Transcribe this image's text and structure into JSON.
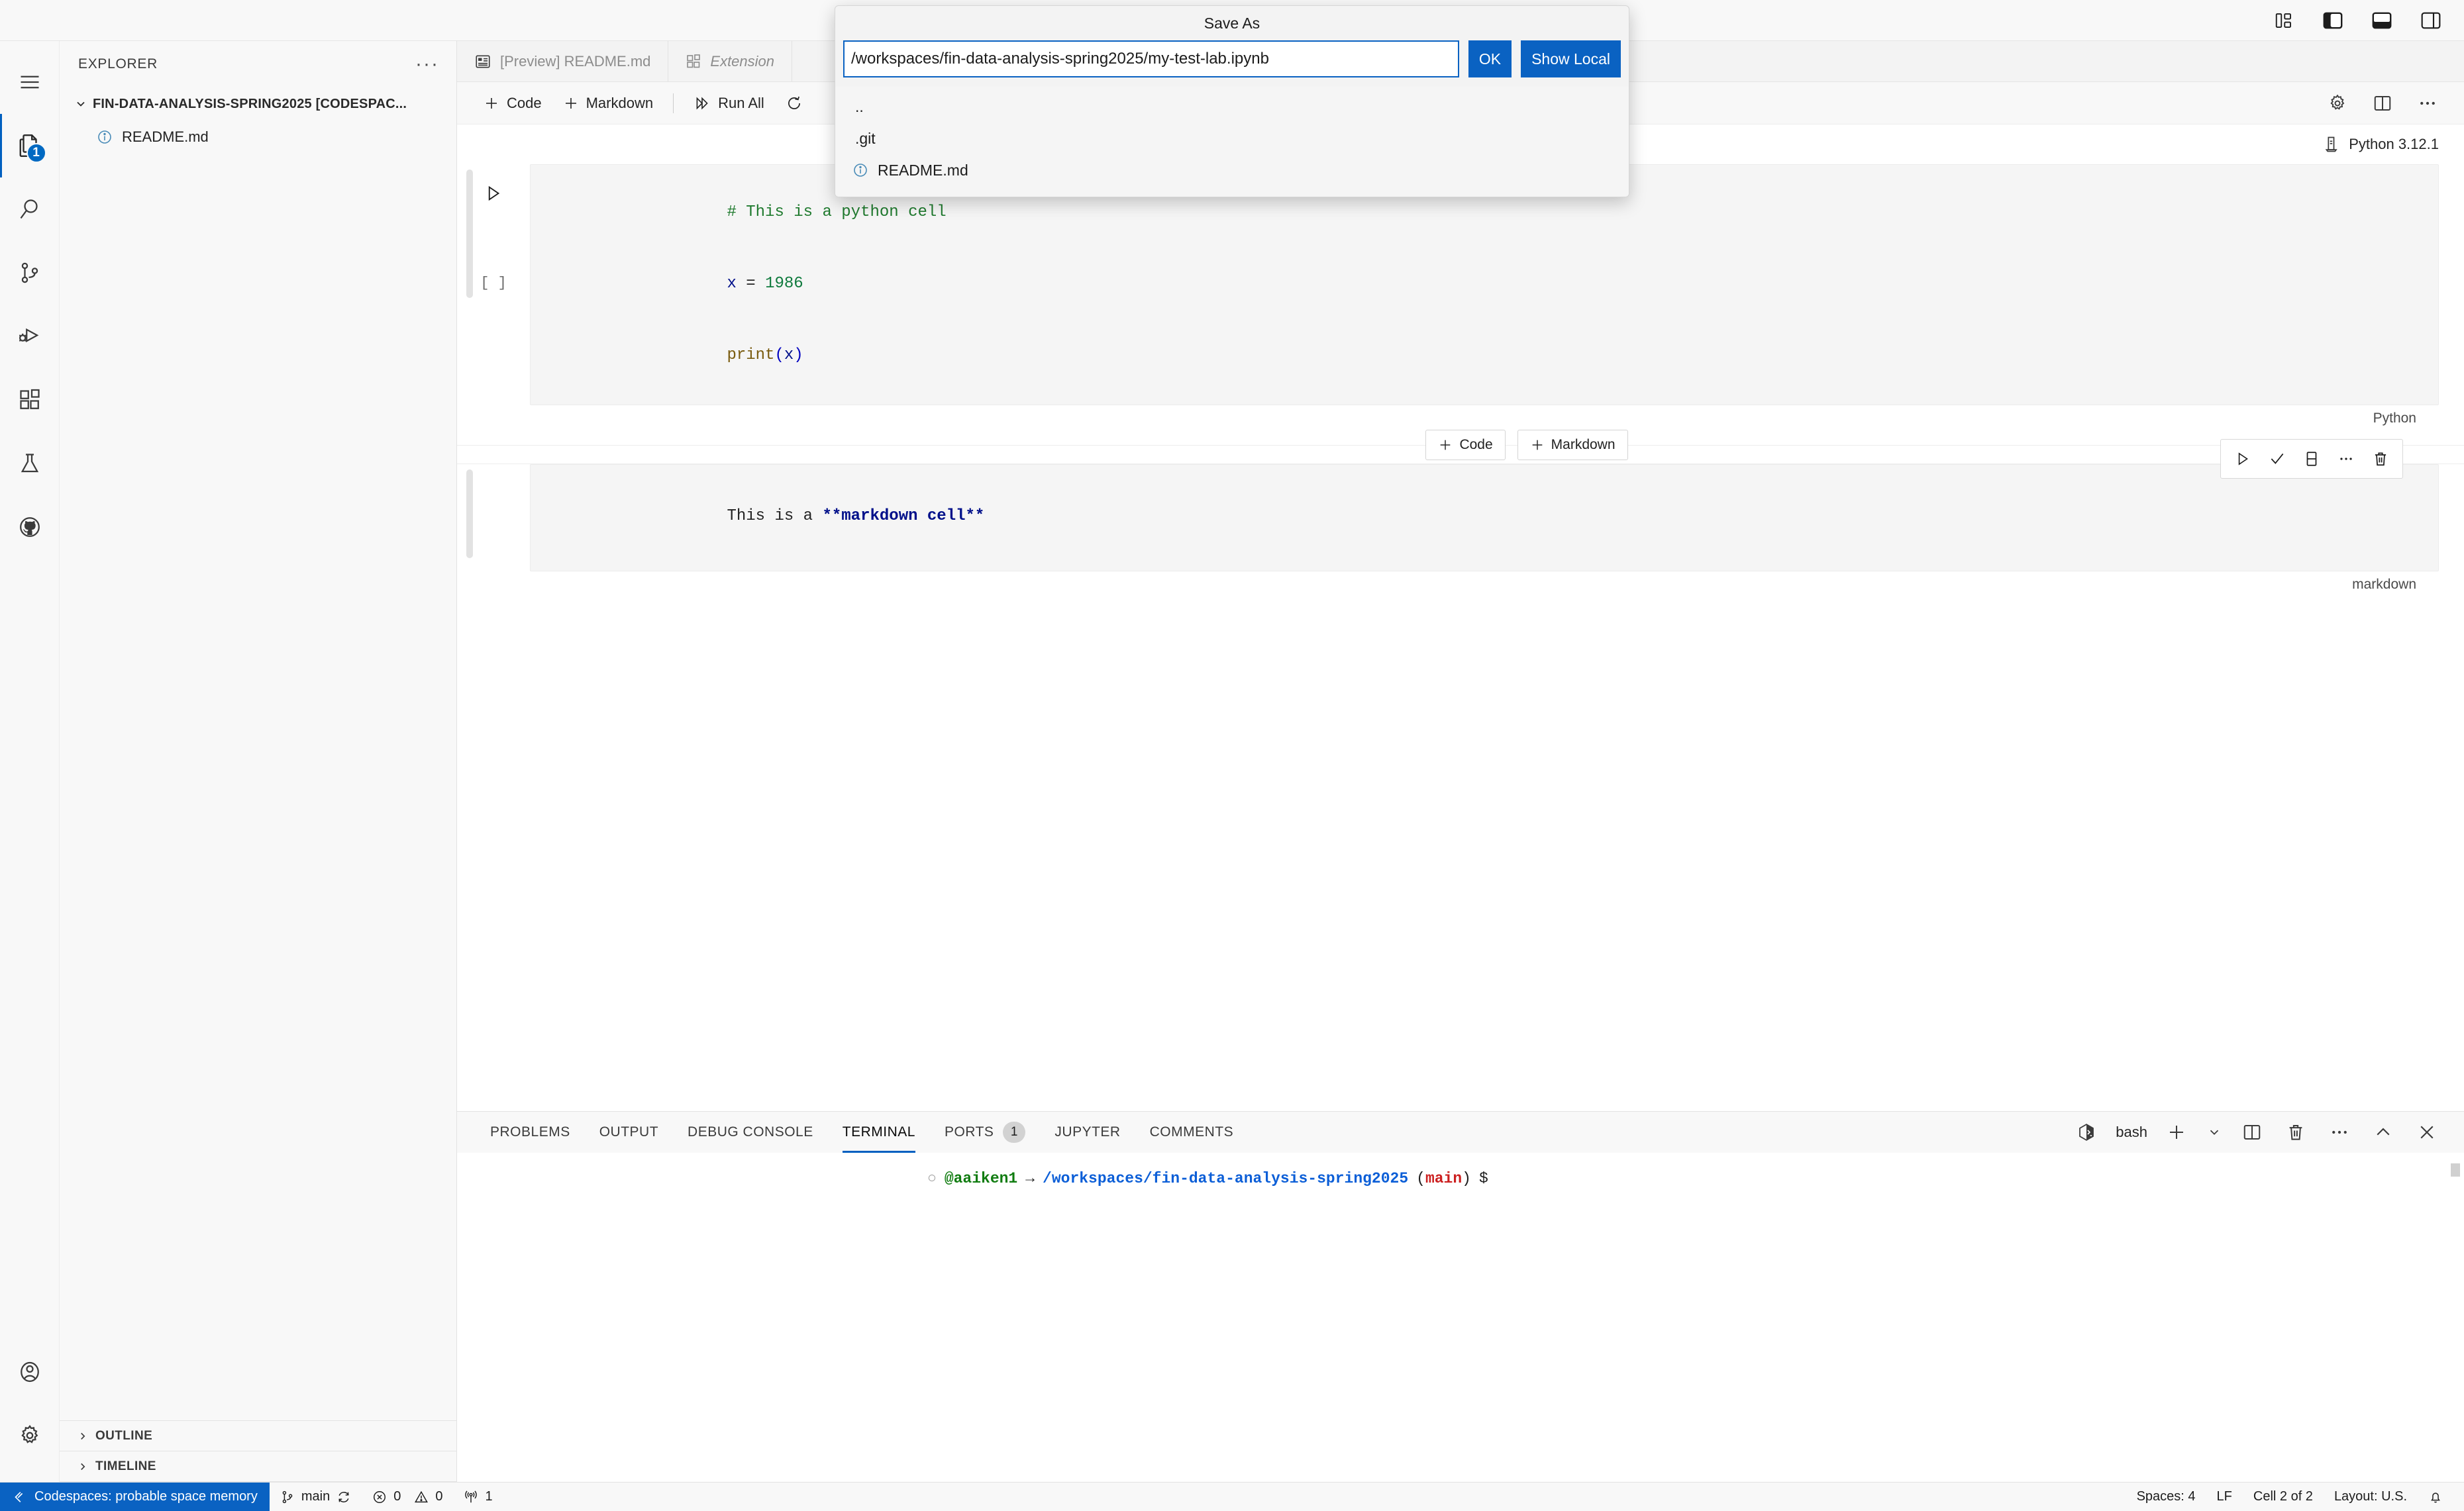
{
  "titlebar": {
    "controls": [
      {
        "name": "customize-layout-icon",
        "label": "Customize Layout",
        "active": false
      },
      {
        "name": "toggle-primary-sidebar-icon",
        "label": "Toggle Primary Side Bar",
        "active": true
      },
      {
        "name": "toggle-panel-icon",
        "label": "Toggle Panel",
        "active": true
      },
      {
        "name": "toggle-secondary-sidebar-icon",
        "label": "Toggle Secondary Side Bar",
        "active": false
      }
    ]
  },
  "activitybar": {
    "items": [
      {
        "name": "menu",
        "label": "Application Menu",
        "icon": "hamburger-icon",
        "active": false,
        "badge": null
      },
      {
        "name": "explorer",
        "label": "Explorer",
        "icon": "files-icon",
        "active": true,
        "badge": "1"
      },
      {
        "name": "search",
        "label": "Search",
        "icon": "search-icon",
        "active": false,
        "badge": null
      },
      {
        "name": "source-control",
        "label": "Source Control",
        "icon": "source-control-icon",
        "active": false,
        "badge": null
      },
      {
        "name": "run-debug",
        "label": "Run and Debug",
        "icon": "run-debug-icon",
        "active": false,
        "badge": null
      },
      {
        "name": "extensions",
        "label": "Extensions",
        "icon": "extensions-icon",
        "active": false,
        "badge": null
      },
      {
        "name": "testing",
        "label": "Testing",
        "icon": "beaker-icon",
        "active": false,
        "badge": null
      },
      {
        "name": "github",
        "label": "GitHub",
        "icon": "github-icon",
        "active": false,
        "badge": null
      }
    ],
    "bottom": [
      {
        "name": "accounts",
        "label": "Accounts",
        "icon": "account-icon"
      },
      {
        "name": "manage",
        "label": "Manage",
        "icon": "gear-icon"
      }
    ]
  },
  "sidebar": {
    "title": "EXPLORER",
    "more_actions": "···",
    "root_folder": "FIN-DATA-ANALYSIS-SPRING2025 [CODESPAC...",
    "files": [
      {
        "name": "README.md",
        "icon": "info-file-icon"
      }
    ],
    "sections": [
      {
        "label": "OUTLINE",
        "expanded": false
      },
      {
        "label": "TIMELINE",
        "expanded": false
      }
    ]
  },
  "tabs": [
    {
      "label": "[Preview] README.md",
      "icon": "preview-icon",
      "italic": false,
      "active": false
    },
    {
      "label": "Extension",
      "icon": "extensions-icon",
      "italic": true,
      "active": false
    }
  ],
  "notebook_toolbar": {
    "add_code": "Code",
    "add_markdown": "Markdown",
    "run_all": "Run All",
    "restart_icon": "restart-icon",
    "right_icons": [
      {
        "name": "gear-icon",
        "label": "Settings"
      },
      {
        "name": "split-editor-icon",
        "label": "Split Editor"
      },
      {
        "name": "more-actions-icon",
        "label": "More Actions"
      }
    ]
  },
  "kernel": {
    "icon": "kernel-icon",
    "label": "Python 3.12.1"
  },
  "cells": [
    {
      "type": "code",
      "language_label": "Python",
      "execution_count": "[ ]",
      "lines": [
        {
          "tokens": [
            {
              "t": "# This is a python cell",
              "c": "tok-comment"
            }
          ]
        },
        {
          "tokens": [
            {
              "t": "x",
              "c": "tok-var"
            },
            {
              "t": " = ",
              "c": "tok-op"
            },
            {
              "t": "1986",
              "c": "tok-num"
            }
          ]
        },
        {
          "tokens": [
            {
              "t": "print",
              "c": "tok-fn"
            },
            {
              "t": "(",
              "c": "tok-paren"
            },
            {
              "t": "x",
              "c": "tok-var"
            },
            {
              "t": ")",
              "c": "tok-paren"
            }
          ]
        }
      ]
    },
    {
      "type": "markdown",
      "language_label": "markdown",
      "lines": [
        {
          "tokens": [
            {
              "t": "This is a ",
              "c": "tok-op"
            },
            {
              "t": "**markdown cell**",
              "c": "tok-var"
            }
          ]
        }
      ],
      "toolbar_icons": [
        {
          "name": "run-cell-icon",
          "label": "Execute Cell"
        },
        {
          "name": "check-icon",
          "label": "Stop Editing Cell"
        },
        {
          "name": "split-cell-icon",
          "label": "Split Cell"
        },
        {
          "name": "more-actions-icon",
          "label": "More Actions"
        },
        {
          "name": "delete-icon",
          "label": "Delete Cell"
        }
      ]
    }
  ],
  "insert_buttons": {
    "code": "Code",
    "markdown": "Markdown"
  },
  "panel": {
    "tabs": [
      {
        "label": "PROBLEMS",
        "active": false,
        "badge": null
      },
      {
        "label": "OUTPUT",
        "active": false,
        "badge": null
      },
      {
        "label": "DEBUG CONSOLE",
        "active": false,
        "badge": null
      },
      {
        "label": "TERMINAL",
        "active": true,
        "badge": null
      },
      {
        "label": "PORTS",
        "active": false,
        "badge": "1"
      },
      {
        "label": "JUPYTER",
        "active": false,
        "badge": null
      },
      {
        "label": "COMMENTS",
        "active": false,
        "badge": null
      }
    ],
    "shell_label": "bash",
    "right_icons": [
      {
        "name": "terminal-bash-icon",
        "label": "bash"
      },
      {
        "name": "new-terminal-icon",
        "label": "New Terminal"
      },
      {
        "name": "chevron-down-icon",
        "label": "Launch Profile"
      },
      {
        "name": "split-terminal-icon",
        "label": "Split Terminal"
      },
      {
        "name": "kill-terminal-icon",
        "label": "Kill Terminal"
      },
      {
        "name": "more-actions-icon",
        "label": "Views and More Actions"
      },
      {
        "name": "maximize-panel-icon",
        "label": "Maximize Panel Size"
      },
      {
        "name": "close-panel-icon",
        "label": "Close Panel"
      }
    ],
    "terminal_line": {
      "marker": "○",
      "user": "@aaiken1",
      "arrow": "→",
      "path": "/workspaces/fin-data-analysis-spring2025",
      "open_paren": "(",
      "branch": "main",
      "close_paren": ")",
      "prompt": "$"
    }
  },
  "statusbar": {
    "remote": "Codespaces: probable space memory",
    "remote_icon": "remote-icon",
    "branch": "main",
    "branch_icon": "source-control-icon",
    "sync_icon": "sync-icon",
    "errors": "0",
    "warnings": "0",
    "ports": "1",
    "error_icon": "error-icon",
    "warning_icon": "warning-icon",
    "ports_icon": "radio-tower-icon",
    "spaces": "Spaces: 4",
    "eol": "LF",
    "cell_position": "Cell 2 of 2",
    "layout": "Layout: U.S.",
    "bell_icon": "bell-icon"
  },
  "quickinput": {
    "title": "Save As",
    "value": "/workspaces/fin-data-analysis-spring2025/my-test-lab.ipynb",
    "ok_label": "OK",
    "show_local_label": "Show Local",
    "items": [
      {
        "label": "..",
        "icon": null
      },
      {
        "label": ".git",
        "icon": null
      },
      {
        "label": "README.md",
        "icon": "info-file-icon"
      }
    ]
  },
  "colors": {
    "accent": "#0a62c2",
    "statusbar_remote_bg": "#0a62c2",
    "comment_green": "#1f7a2e",
    "string_blue": "#00108a",
    "terminal_path_blue": "#0b5ed7",
    "terminal_branch_red": "#cc2020",
    "terminal_user_green": "#107c10"
  }
}
